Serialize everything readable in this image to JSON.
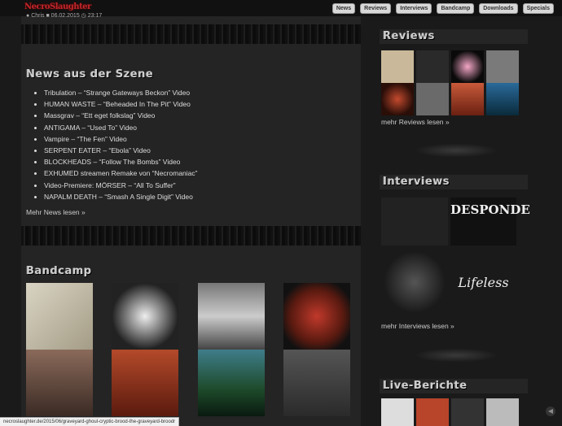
{
  "site": {
    "logo_text": "NecroSlaughter"
  },
  "nav": [
    {
      "label": "News"
    },
    {
      "label": "Reviews"
    },
    {
      "label": "Interviews"
    },
    {
      "label": "Bandcamp"
    },
    {
      "label": "Downloads"
    },
    {
      "label": "Specials"
    }
  ],
  "post_meta": {
    "author": "Chris",
    "date": "06.02.2015",
    "time": "23:17"
  },
  "news": {
    "title": "News aus der Szene",
    "items": [
      "Tribulation – “Strange Gateways Beckon” Video",
      "HUMAN WASTE – “Beheaded In The Pit” Video",
      "Massgrav – “Ett eget folkslag” Video",
      "ANTIGAMA – “Used To” Video",
      "Vampire – “The Fen” Video",
      "SERPENT EATER – “Ebola” Video",
      "BLOCKHEADS – “Follow The Bombs” Video",
      "EXHUMED streamen Remake von “Necromaniac”",
      "Video-Premiere: MÖRSER – “All To Suffer”",
      "NAPALM DEATH – “Smash A Single Digit” Video"
    ],
    "more": "Mehr News lesen »"
  },
  "bandcamp": {
    "title": "Bandcamp"
  },
  "reviews": {
    "title": "Reviews",
    "more": "mehr Reviews lesen »"
  },
  "interviews": {
    "title": "Interviews",
    "more": "mehr Interviews lesen »",
    "logos": [
      "DESPONDE",
      "Lifeless"
    ]
  },
  "live": {
    "title": "Live-Berichte"
  },
  "status_url": "necroslaughter.de/2015/06/graveyard-ghoul-cryptic-brood-the-graveyard-broodr"
}
